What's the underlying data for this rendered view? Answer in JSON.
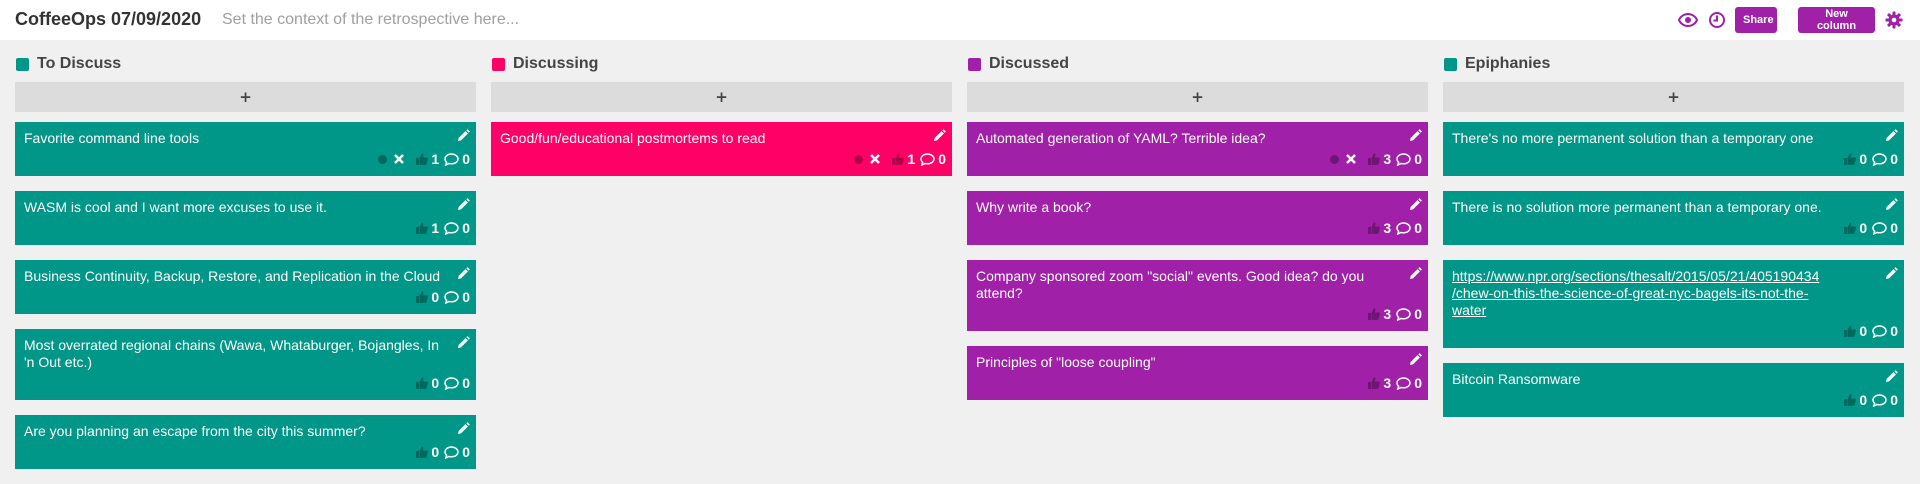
{
  "board": {
    "title": "CoffeeOps 07/09/2020",
    "context_placeholder": "Set the context of the retrospective here...",
    "share_label": "Share",
    "new_column_label": "New column",
    "accent_color": "#a020a8"
  },
  "icons": {
    "visibility": "eye-icon",
    "timer": "clock-icon",
    "settings": "gear-icon",
    "edit": "pencil-icon",
    "vote": "thumbs-up-icon",
    "comment": "speech-bubble-icon",
    "remove_vote": "x-icon"
  },
  "columns": [
    {
      "title": "To Discuss",
      "color": "#009688",
      "add_label": "+",
      "cards": [
        {
          "text": "Favorite command line tools",
          "votes": "1",
          "comments": "0",
          "voted": true
        },
        {
          "text": "WASM is cool and I want more excuses to use it.",
          "votes": "1",
          "comments": "0",
          "voted": false
        },
        {
          "text": "Business Continuity, Backup, Restore, and Replication in the Cloud",
          "votes": "0",
          "comments": "0",
          "voted": false
        },
        {
          "text": "Most overrated regional chains (Wawa, Whataburger, Bojangles, In 'n Out etc.)",
          "votes": "0",
          "comments": "0",
          "voted": false
        },
        {
          "text": "Are you planning an escape from the city this summer?",
          "votes": "0",
          "comments": "0",
          "voted": false
        }
      ]
    },
    {
      "title": "Discussing",
      "color": "#ff0066",
      "add_label": "+",
      "cards": [
        {
          "text": "Good/fun/educational postmortems to read",
          "votes": "1",
          "comments": "0",
          "voted": true
        }
      ]
    },
    {
      "title": "Discussed",
      "color": "#a020a8",
      "add_label": "+",
      "cards": [
        {
          "text": "Automated generation of YAML? Terrible idea?",
          "votes": "3",
          "comments": "0",
          "voted": true
        },
        {
          "text": "Why write a book?",
          "votes": "3",
          "comments": "0",
          "voted": false
        },
        {
          "text": "Company sponsored zoom \"social\" events. Good idea? do you attend?",
          "votes": "3",
          "comments": "0",
          "voted": false
        },
        {
          "text": "Principles of \"loose coupling\"",
          "votes": "3",
          "comments": "0",
          "voted": false
        }
      ]
    },
    {
      "title": "Epiphanies",
      "color": "#009688",
      "add_label": "+",
      "cards": [
        {
          "text": "There's no more permanent solution than a temporary one",
          "votes": "0",
          "comments": "0",
          "voted": false
        },
        {
          "text": "There is no solution more permanent than a temporary one.",
          "votes": "0",
          "comments": "0",
          "voted": false
        },
        {
          "text": "https://www.npr.org/sections/thesalt/2015/05/21/405190434/chew-on-this-the-science-of-great-nyc-bagels-its-not-the-water",
          "display_lines": [
            "https://www.npr.org/sections/thesalt/2015/05/21/405190434",
            "/chew-on-this-the-science-of-great-nyc-bagels-its-not-the-",
            "water"
          ],
          "votes": "0",
          "comments": "0",
          "voted": false,
          "is_link": true
        },
        {
          "text": "Bitcoin Ransomware",
          "votes": "0",
          "comments": "0",
          "voted": false
        }
      ]
    }
  ]
}
